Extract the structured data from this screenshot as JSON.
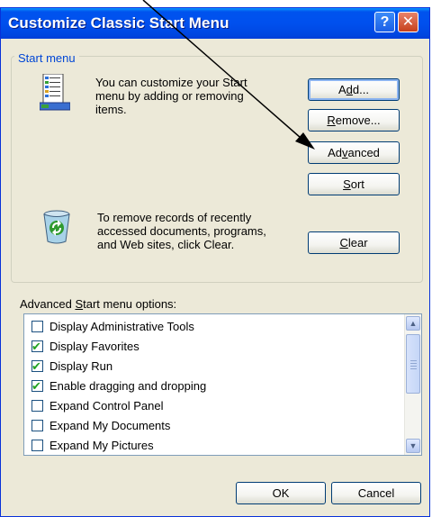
{
  "window": {
    "title": "Customize Classic Start Menu",
    "help_label": "?",
    "close_label": "✕"
  },
  "start_menu_group": {
    "legend": "Start menu",
    "customize_text": [
      "You can customize your Start",
      "menu by adding or removing",
      "items."
    ],
    "remove_records_text": [
      "To remove records of recently",
      "accessed documents, programs,",
      "and Web sites, click Clear."
    ],
    "buttons": {
      "add": {
        "pre": "A",
        "mn": "d",
        "post": "d..."
      },
      "remove": {
        "pre": "",
        "mn": "R",
        "post": "emove..."
      },
      "advanced": {
        "pre": "Ad",
        "mn": "v",
        "post": "anced"
      },
      "sort": {
        "pre": "",
        "mn": "S",
        "post": "ort"
      },
      "clear": {
        "pre": "",
        "mn": "C",
        "post": "lear"
      }
    }
  },
  "advanced_options": {
    "label": {
      "pre": "Advanced ",
      "mn": "S",
      "post": "tart menu options:"
    },
    "items": [
      {
        "label": "Display Administrative Tools",
        "checked": false
      },
      {
        "label": "Display Favorites",
        "checked": true
      },
      {
        "label": "Display Run",
        "checked": true
      },
      {
        "label": "Enable dragging and dropping",
        "checked": true
      },
      {
        "label": "Expand Control Panel",
        "checked": false
      },
      {
        "label": "Expand My Documents",
        "checked": false
      },
      {
        "label": "Expand My Pictures",
        "checked": false
      }
    ],
    "scroll_up": "▲",
    "scroll_down": "▼"
  },
  "footer": {
    "ok": "OK",
    "cancel": "Cancel"
  },
  "check_mark": "✔",
  "colors": {
    "titlebar": "#0050ee",
    "dialog_bg": "#ece9d8",
    "legend_text": "#0046d5",
    "check": "#21a121"
  }
}
